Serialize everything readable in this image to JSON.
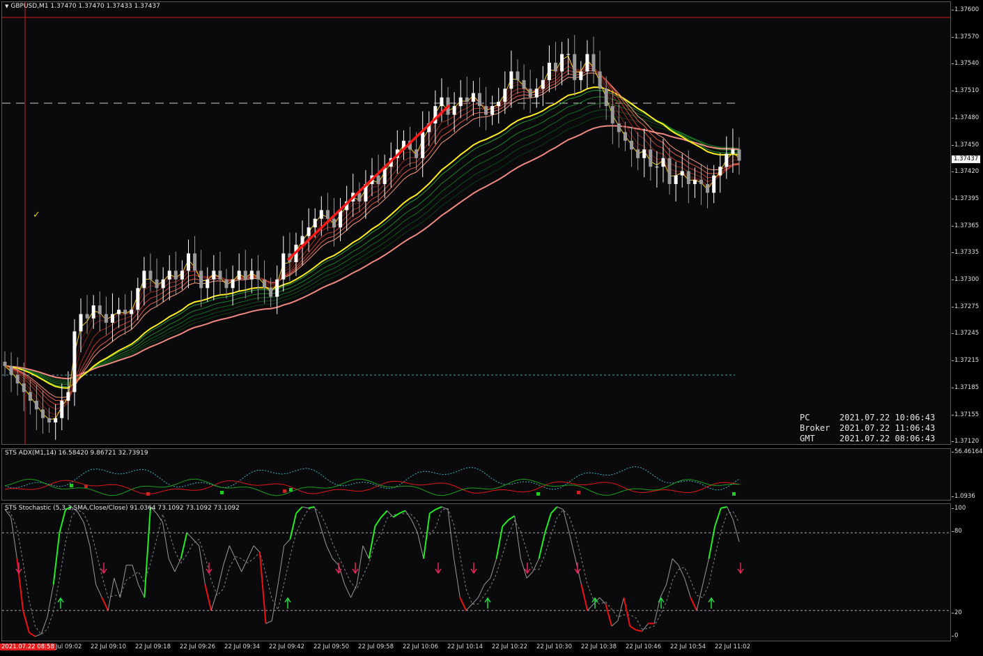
{
  "main_chart": {
    "title": "GBPUSD,M1  1.37470 1.37470 1.37433 1.37437",
    "current_price": "1.37437",
    "y_ticks": [
      "1.37600",
      "1.37570",
      "1.37540",
      "1.37510",
      "1.37480",
      "1.37450",
      "1.37420",
      "1.37395",
      "1.37365",
      "1.37335",
      "1.37300",
      "1.37275",
      "1.37245",
      "1.37215",
      "1.37185",
      "1.37155",
      "1.37120"
    ],
    "clock": [
      {
        "label": "PC",
        "value": "2021.07.22 10:06:43"
      },
      {
        "label": "Broker",
        "value": "2021.07.22 11:06:43"
      },
      {
        "label": "GMT",
        "value": "2021.07.22 08:06:43"
      }
    ],
    "marker_glyph": "✓"
  },
  "adx_panel": {
    "title": "STS ADX(M1,14) 16.58420 9.86721 32.73919",
    "y_ticks": [
      "56.46164",
      "1.0936"
    ]
  },
  "stoch_panel": {
    "title": "STS Stochastic (5,3,3,SMA,Close/Close) 91.0364 73.1092 73.1092 73.1092",
    "y_ticks": [
      "100",
      "80",
      "20",
      "0"
    ]
  },
  "time_axis": {
    "first": "2021.07.22 08:58",
    "labels": [
      "Jul 09:02",
      "22 Jul 09:10",
      "22 Jul 09:18",
      "22 Jul 09:26",
      "22 Jul 09:34",
      "22 Jul 09:42",
      "22 Jul 09:50",
      "22 Jul 09:58",
      "22 Jul 10:06",
      "22 Jul 10:14",
      "22 Jul 10:22",
      "22 Jul 10:30",
      "22 Jul 10:38",
      "22 Jul 10:46",
      "22 Jul 10:54",
      "22 Jul 11:02"
    ]
  },
  "colors": {
    "bg": "#0a0a0c",
    "bull": "#ffffff",
    "bear": "#9a9a9a",
    "trend_line": "#ff1a1a",
    "ma_yellow": "#ffee22",
    "ma_salmon": "#f08a80",
    "stoch_up": "#22ee22",
    "stoch_down": "#ee1111"
  },
  "chart_data": {
    "type": "candlestick",
    "symbol": "GBPUSD",
    "timeframe": "M1",
    "ylim": [
      1.3711,
      1.3762
    ],
    "closes": [
      1.372,
      1.3719,
      1.3718,
      1.3717,
      1.3716,
      1.3715,
      1.3714,
      1.37135,
      1.3714,
      1.3716,
      1.3717,
      1.3724,
      1.3726,
      1.37255,
      1.3727,
      1.3726,
      1.3725,
      1.3726,
      1.37265,
      1.3726,
      1.37265,
      1.3729,
      1.3731,
      1.373,
      1.3729,
      1.373,
      1.3731,
      1.373,
      1.3731,
      1.3733,
      1.3731,
      1.3729,
      1.373,
      1.3731,
      1.373,
      1.3729,
      1.373,
      1.3731,
      1.373,
      1.3731,
      1.373,
      1.3729,
      1.3728,
      1.373,
      1.3733,
      1.3732,
      1.3734,
      1.3735,
      1.3736,
      1.3737,
      1.3738,
      1.3737,
      1.3736,
      1.3738,
      1.3739,
      1.374,
      1.3739,
      1.3741,
      1.3742,
      1.3741,
      1.3743,
      1.3744,
      1.3745,
      1.3746,
      1.3745,
      1.3744,
      1.3747,
      1.3748,
      1.375,
      1.3751,
      1.3749,
      1.375,
      1.3751,
      1.37505,
      1.37515,
      1.375,
      1.3749,
      1.375,
      1.37505,
      1.3752,
      1.3754,
      1.3753,
      1.3752,
      1.3751,
      1.3752,
      1.3753,
      1.3755,
      1.3754,
      1.3756,
      1.3756,
      1.3753,
      1.3754,
      1.3756,
      1.3754,
      1.3752,
      1.375,
      1.3748,
      1.3747,
      1.3746,
      1.3745,
      1.3744,
      1.3745,
      1.3743,
      1.3743,
      1.3744,
      1.3741,
      1.3742,
      1.37425,
      1.3741,
      1.37415,
      1.3741,
      1.374,
      1.3742,
      1.3743,
      1.37445,
      1.3745,
      1.37437
    ]
  }
}
